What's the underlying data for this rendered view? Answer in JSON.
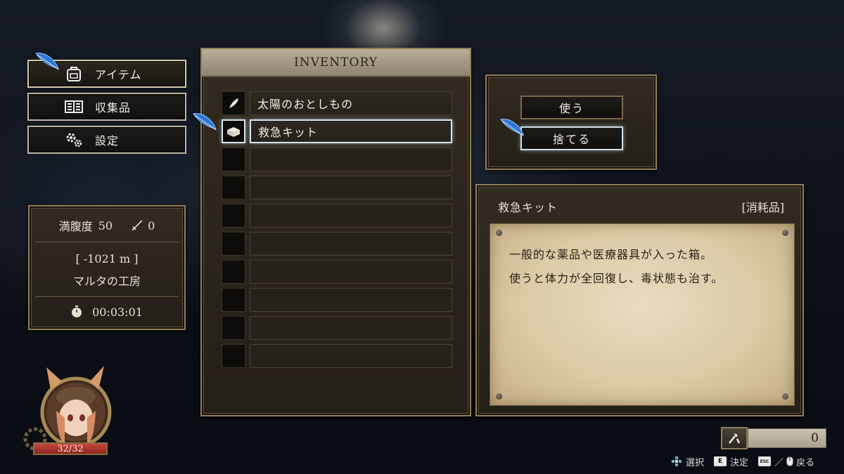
{
  "menu": {
    "items": [
      {
        "label": "アイテム",
        "icon": "backpack-icon",
        "active": true
      },
      {
        "label": "収集品",
        "icon": "collection-book-icon",
        "active": false
      },
      {
        "label": "設定",
        "icon": "gear-icon",
        "active": false
      }
    ]
  },
  "status": {
    "satiety_label": "満腹度",
    "satiety_value": "50",
    "weapon_icon": "sword-icon",
    "weapon_value": "0",
    "depth": "[ -1021 m ]",
    "location": "マルタの工房",
    "timer_icon": "stopwatch-icon",
    "time": "00:03:01"
  },
  "character": {
    "hp": "32/32",
    "hp_fraction": 1.0
  },
  "inventory": {
    "title": "INVENTORY",
    "items": [
      {
        "name": "太陽のおとしもの",
        "icon": "feather-icon"
      },
      {
        "name": "救急キット",
        "icon": "first-aid-kit-icon",
        "selected": true
      },
      {
        "name": ""
      },
      {
        "name": ""
      },
      {
        "name": ""
      },
      {
        "name": ""
      },
      {
        "name": ""
      },
      {
        "name": ""
      },
      {
        "name": ""
      }
    ]
  },
  "actions": {
    "use_label": "使う",
    "discard_label": "捨てる"
  },
  "detail": {
    "name": "救急キット",
    "category": "[消耗品]",
    "lines": [
      "一般的な薬品や医療器具が入った箱。",
      "使うと体力が全回復し、毒状態も治す。"
    ]
  },
  "currency": {
    "icon": "tools-icon",
    "value": "0"
  },
  "hints": {
    "select_label": "選択",
    "confirm_key": "E",
    "confirm_label": "決定",
    "back_key": "ESC",
    "back_separator": "／",
    "back_label": "戻る"
  },
  "colors": {
    "frame_border": "#8f7c57",
    "parchment": "#dccaa5",
    "focus_glow": "#d9e6ee",
    "hp_bar": "#a8322c"
  }
}
